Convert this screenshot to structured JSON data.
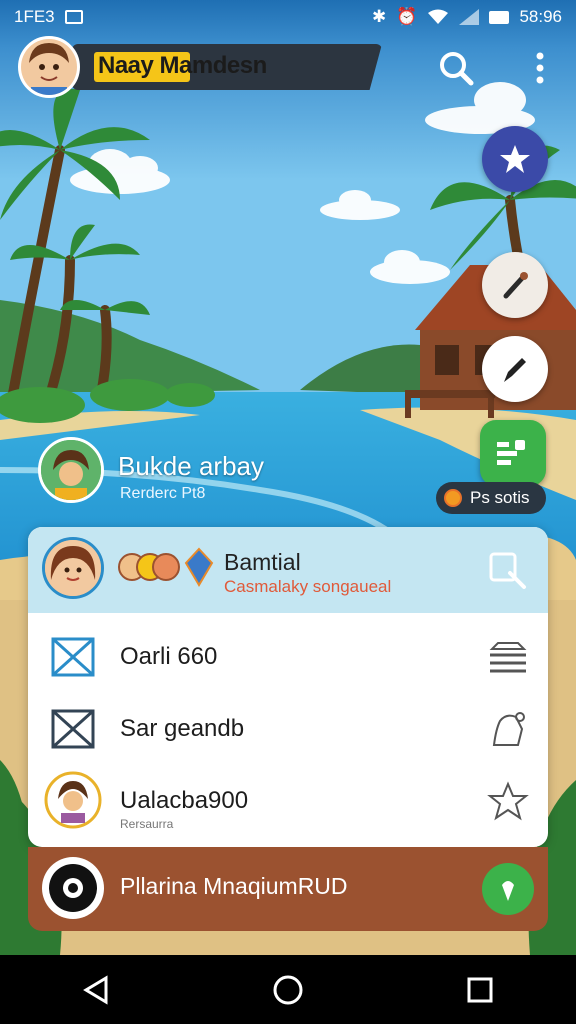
{
  "status_bar": {
    "left_text": "1FE3",
    "time": "58:96"
  },
  "app_bar": {
    "user_name_highlight": "Naay",
    "user_name_rest": " Mamdesn"
  },
  "location": {
    "title": "Bukde arbay",
    "subtitle": "Rerderc Pt8"
  },
  "points": {
    "label": "Ps sotis"
  },
  "panel": {
    "header_title": "Bamtial",
    "header_subtitle": "Casmalaky songaueal",
    "rows": [
      {
        "label": "Oarli 660",
        "sub": ""
      },
      {
        "label": "Sar geandb",
        "sub": ""
      },
      {
        "label": "Ualacba900",
        "sub": "Rersaurra"
      }
    ]
  },
  "bottom_bar": {
    "label": "Pllarina MnaqiumRUD"
  },
  "icons": {
    "status": [
      "gallery-icon",
      "bluetooth-icon",
      "alarm-icon",
      "wifi-icon",
      "signal-icon",
      "battery-icon"
    ],
    "app_bar": [
      "search-icon",
      "more-vert-icon"
    ],
    "fabs": [
      "star-icon",
      "brush-icon",
      "pen-icon",
      "chart-icon"
    ]
  },
  "colors": {
    "accent_blue": "#2a8dc9",
    "highlight_yellow": "#f5c518",
    "bottom_brown": "#9b5230",
    "green": "#3cb24a",
    "subtitle_red": "#e05a3a"
  }
}
